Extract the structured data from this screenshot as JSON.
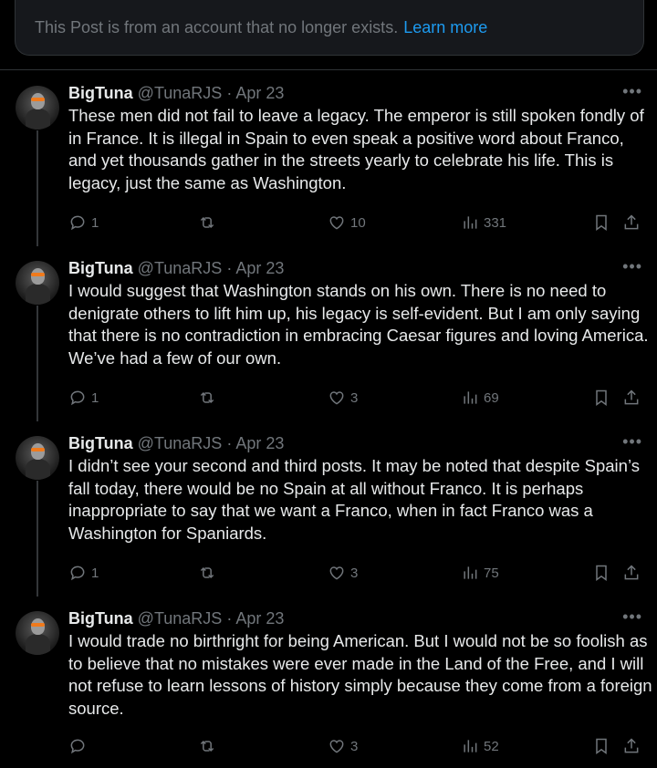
{
  "notice": {
    "text": "This Post is from an account that no longer exists.",
    "link": "Learn more"
  },
  "posts": [
    {
      "name": "BigTuna",
      "handle": "@TunaRJS",
      "sep": "·",
      "date": "Apr 23",
      "text": "These men did not fail to leave a legacy. The emperor is still spoken fondly of in France. It is illegal in Spain to even speak a positive word about Franco, and yet thousands gather in the streets yearly to celebrate his life. This is legacy, just the same as Washington.",
      "replies": "1",
      "reposts": "",
      "likes": "10",
      "views": "331"
    },
    {
      "name": "BigTuna",
      "handle": "@TunaRJS",
      "sep": "·",
      "date": "Apr 23",
      "text": "I would suggest that Washington stands on his own. There is no need to denigrate others to lift him up, his legacy is self-evident. But I am only saying that there is no contradiction in embracing Caesar figures and loving America. We’ve had a few of our own.",
      "replies": "1",
      "reposts": "",
      "likes": "3",
      "views": "69"
    },
    {
      "name": "BigTuna",
      "handle": "@TunaRJS",
      "sep": "·",
      "date": "Apr 23",
      "text": "I didn’t see your second and third posts. It may be noted that despite Spain’s fall today, there would be no Spain at all without Franco. It is perhaps inappropriate to say that we want a Franco, when in fact Franco was a Washington for Spaniards.",
      "replies": "1",
      "reposts": "",
      "likes": "3",
      "views": "75"
    },
    {
      "name": "BigTuna",
      "handle": "@TunaRJS",
      "sep": "·",
      "date": "Apr 23",
      "text": "I would trade no birthright for being American. But I would not be so foolish as to believe that no mistakes were ever made in the Land of the Free, and I will not refuse to learn lessons of history simply because they come from a foreign source.",
      "replies": "",
      "reposts": "",
      "likes": "3",
      "views": "52"
    }
  ],
  "icons": {
    "more": "more-horizontal-icon",
    "reply": "reply-icon",
    "repost": "repost-icon",
    "like": "heart-icon",
    "views": "views-chart-icon",
    "bookmark": "bookmark-icon",
    "share": "share-icon"
  },
  "colors": {
    "background": "#000000",
    "text": "#e7e9ea",
    "muted": "#71767b",
    "link": "#1d9bf0",
    "border": "#2f3336"
  }
}
